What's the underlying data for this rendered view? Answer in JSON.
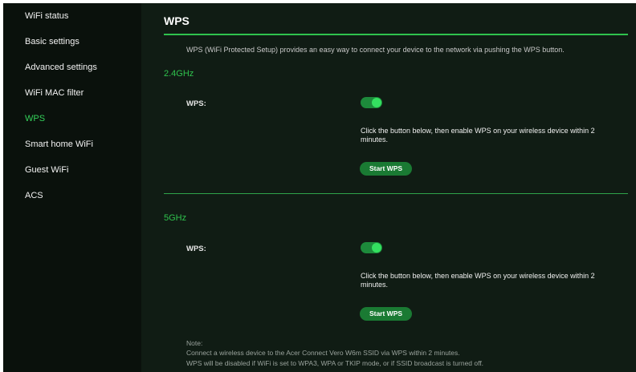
{
  "sidebar": {
    "items": [
      {
        "label": "WiFi status"
      },
      {
        "label": "Basic settings"
      },
      {
        "label": "Advanced settings"
      },
      {
        "label": "WiFi MAC filter"
      },
      {
        "label": "WPS",
        "active": true
      },
      {
        "label": "Smart home WiFi"
      },
      {
        "label": "Guest WiFi"
      },
      {
        "label": "ACS"
      }
    ]
  },
  "main": {
    "title": "WPS",
    "description": "WPS (WiFi Protected Setup) provides an easy way to connect your device to the network via pushing the WPS button.",
    "bands": [
      {
        "name": "2.4GHz",
        "wps_label": "WPS:",
        "wps_enabled": true,
        "hint": "Click the button below, then enable WPS on your wireless device within 2 minutes.",
        "button": "Start WPS"
      },
      {
        "name": "5GHz",
        "wps_label": "WPS:",
        "wps_enabled": true,
        "hint": "Click the button below, then enable WPS on your wireless device within 2 minutes.",
        "button": "Start WPS"
      }
    ],
    "note": {
      "title": "Note:",
      "lines": [
        "Connect a wireless device to the Acer Connect Vero W6m SSID via WPS within 2 minutes.",
        "WPS will be disabled if WiFi is set to WPA3, WPA or TKIP mode, or if SSID broadcast is turned off."
      ]
    }
  },
  "colors": {
    "accent": "#2fc24d",
    "background": "#101c14",
    "sidebar_bg": "#0a110c",
    "button_bg": "#1a7a33"
  }
}
